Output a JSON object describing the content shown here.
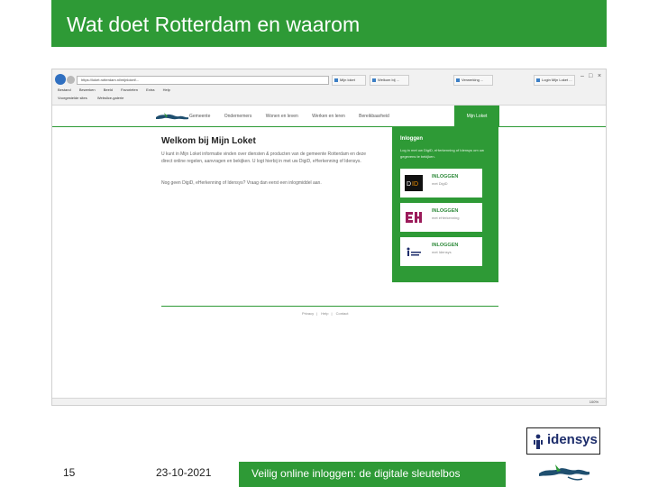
{
  "slide": {
    "title": "Wat doet Rotterdam en waarom",
    "page_number": "15",
    "date": "23-10-2021",
    "footer_text": "Veilig online inloggen: de digitale sleutelbos",
    "brand_logo_text": "idensys"
  },
  "colors": {
    "brand_green": "#2e9a36",
    "idensys_navy": "#1d2d6b"
  },
  "browser": {
    "address": "https://loket.rotterdam.nl/mijnloket/...",
    "tabs": [
      "Mijn loket",
      "Welkom bij ...",
      "Verwerking ...",
      "Login Mijn Loket ..."
    ],
    "menu": [
      "Bestand",
      "Bewerken",
      "Beeld",
      "Favorieten",
      "Extra",
      "Help"
    ],
    "favorites": [
      "Voorgestelde sites",
      "Webslice-galerie"
    ],
    "zoom": "100%"
  },
  "site": {
    "nav": [
      "Gemeente",
      "Ondernemers",
      "Wonen en leven",
      "Werken en leren",
      "Bereikbaarheid"
    ],
    "mijn_loket_tab": "Mijn Loket",
    "welcome_title": "Welkom bij Mijn Loket",
    "welcome_paragraph_1": "U kunt in Mijn Loket informatie vinden over diensten & producten van de gemeente Rotterdam en deze direct online regelen, aanvragen en bekijken. U logt hierbij in met uw DigiD, eHerkenning of Idensys.",
    "welcome_paragraph_2": "Nog geen DigiD, eHerkenning of Idensys? Vraag dan eerst een inlogmiddel aan.",
    "login_panel": {
      "title": "Inloggen",
      "text": "Log in met uw DigiD, eHerkenning of Idensys om uw gegevens te bekijken.",
      "options": [
        {
          "cta": "INLOGGEN",
          "sub": "met DigiD",
          "logo": "digid-logo"
        },
        {
          "cta": "INLOGGEN",
          "sub": "met eHerkenning",
          "logo": "eherkenning-logo"
        },
        {
          "cta": "INLOGGEN",
          "sub": "met Idensys",
          "logo": "idensys-logo"
        }
      ]
    },
    "footer_links": [
      "Privacy",
      "Help",
      "Contact"
    ]
  }
}
